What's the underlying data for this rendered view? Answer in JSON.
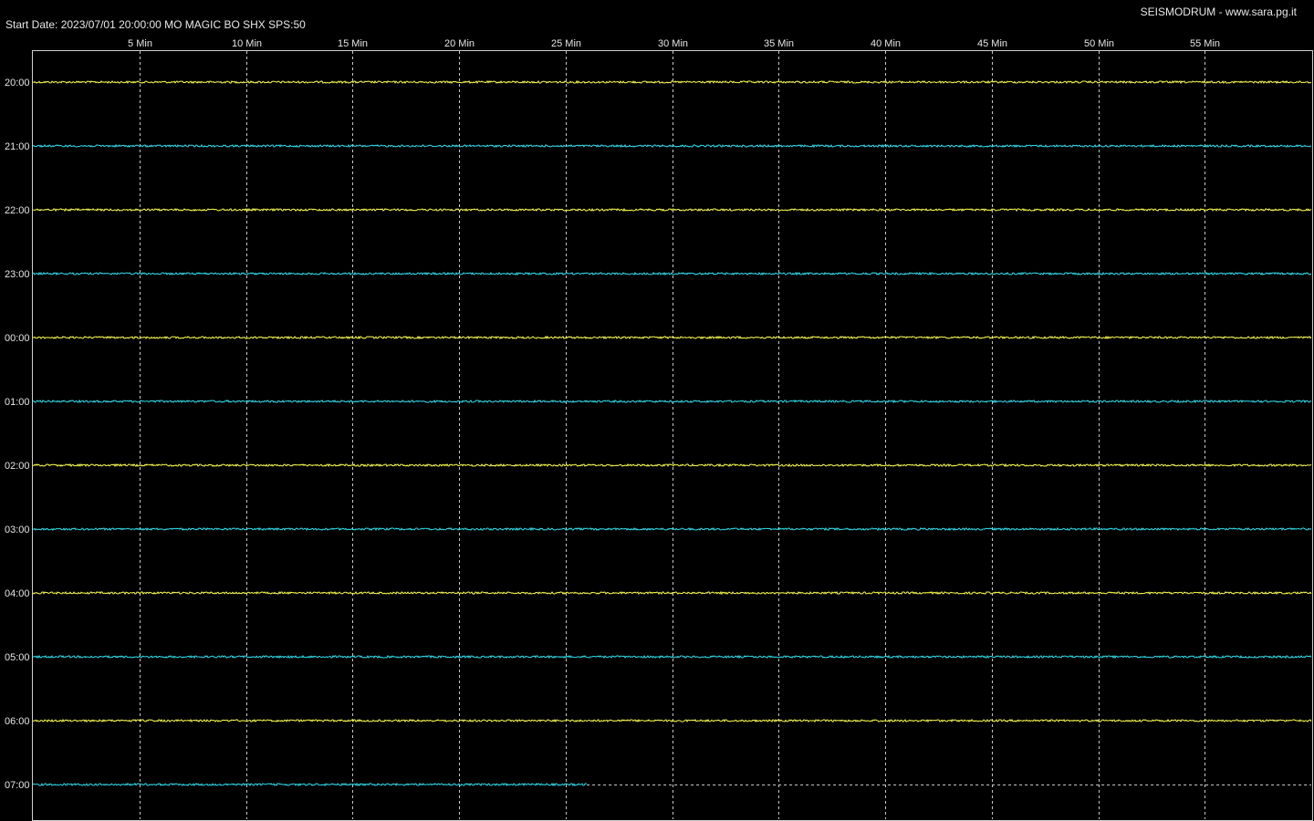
{
  "header": {
    "start_date": "Start Date: 2023/07/01 20:00:00 MO MAGIC BO SHX SPS:50",
    "site": "SEISMODRUM - www.sara.pg.it"
  },
  "chart_data": {
    "type": "line",
    "title": "Start Date: 2023/07/01 20:00:00 MO MAGIC BO SHX SPS:50",
    "x_ticks": [
      "5 Min",
      "10 Min",
      "15 Min",
      "20 Min",
      "25 Min",
      "30 Min",
      "35 Min",
      "40 Min",
      "45 Min",
      "50 Min",
      "55 Min"
    ],
    "xlim": [
      0,
      60
    ],
    "grid": true,
    "colors": {
      "even_trace": "#ffff50",
      "odd_trace": "#30e0f0",
      "grid": "#c8c8c8",
      "background": "#000000"
    },
    "series": [
      {
        "label": "20:00",
        "duration_min": 60,
        "color": "#ffff50"
      },
      {
        "label": "21:00",
        "duration_min": 60,
        "color": "#30e0f0"
      },
      {
        "label": "22:00",
        "duration_min": 60,
        "color": "#ffff50"
      },
      {
        "label": "23:00",
        "duration_min": 60,
        "color": "#30e0f0"
      },
      {
        "label": "00:00",
        "duration_min": 60,
        "color": "#ffff50"
      },
      {
        "label": "01:00",
        "duration_min": 60,
        "color": "#30e0f0"
      },
      {
        "label": "02:00",
        "duration_min": 60,
        "color": "#ffff50"
      },
      {
        "label": "03:00",
        "duration_min": 60,
        "color": "#30e0f0"
      },
      {
        "label": "04:00",
        "duration_min": 60,
        "color": "#ffff50"
      },
      {
        "label": "05:00",
        "duration_min": 60,
        "color": "#30e0f0"
      },
      {
        "label": "06:00",
        "duration_min": 60,
        "color": "#ffff50"
      },
      {
        "label": "07:00",
        "duration_min": 26,
        "color": "#30e0f0"
      }
    ]
  }
}
